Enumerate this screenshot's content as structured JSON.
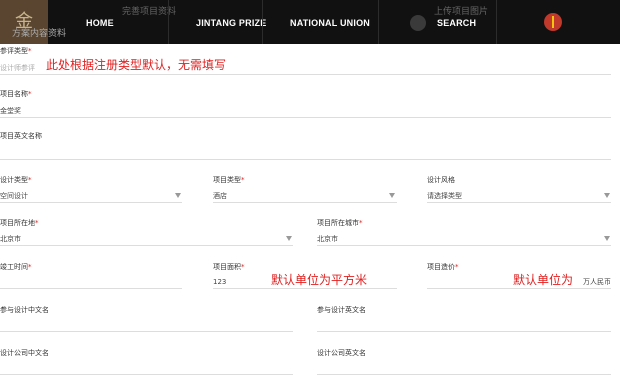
{
  "nav": {
    "logo_text": "金",
    "logo_sub": "方案内容资料",
    "ghost_left": "完善项目资料",
    "ghost_right": "上传项目图片",
    "items": [
      "HOME",
      "JINTANG PRIZE",
      "NATIONAL UNION",
      "SEARCH"
    ]
  },
  "form": {
    "entry_type": {
      "label": "参评类型",
      "value": "设计师参评"
    },
    "note_entry": "此处根据注册类型默认，无需填写",
    "project_name": {
      "label": "项目名称",
      "value": "金堂奖"
    },
    "project_name_en": {
      "label": "项目英文名称",
      "value": ""
    },
    "design_type": {
      "label": "设计类型",
      "value": "空间设计"
    },
    "project_type": {
      "label": "项目类型",
      "value": "酒店"
    },
    "design_style": {
      "label": "设计风格",
      "value": "请选择类型"
    },
    "province": {
      "label": "项目所在地",
      "value": "北京市"
    },
    "city": {
      "label": "项目所在城市",
      "value": "北京市"
    },
    "completion_time": {
      "label": "竣工时间",
      "value": ""
    },
    "area": {
      "label": "项目面积",
      "value": "123"
    },
    "note_area": "默认单位为平方米",
    "cost": {
      "label": "项目造价",
      "value": ""
    },
    "note_cost": "默认单位为",
    "cost_unit": "万人民币",
    "participant_cn": {
      "label": "参与设计中文名"
    },
    "participant_en": {
      "label": "参与设计英文名"
    },
    "company_cn": {
      "label": "设计公司中文名"
    },
    "company_en": {
      "label": "设计公司英文名"
    }
  },
  "colors": {
    "required": "#e02020",
    "nav_bg": "#111111"
  }
}
